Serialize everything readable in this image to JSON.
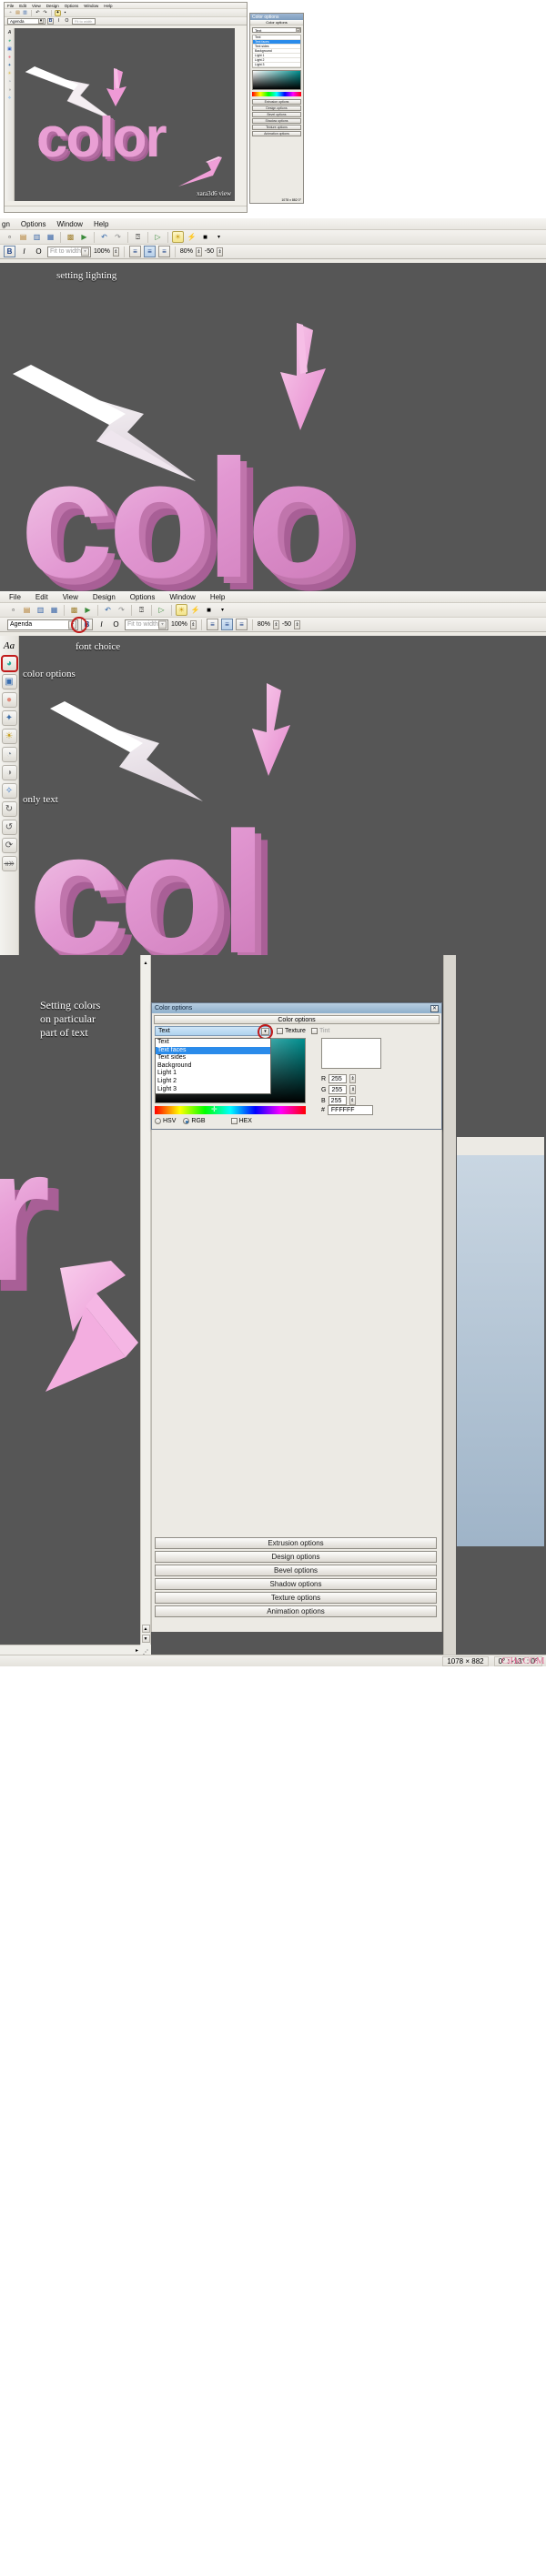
{
  "app": {
    "name": "Xara3D",
    "menu": [
      "File",
      "Edit",
      "View",
      "Design",
      "Options",
      "Window",
      "Help"
    ],
    "menu_short": [
      "gn",
      "Options",
      "Window",
      "Help"
    ]
  },
  "toolbar": {
    "icons": [
      {
        "name": "new-document-icon",
        "glyph": "□"
      },
      {
        "name": "open-folder-icon",
        "glyph": "❐"
      },
      {
        "name": "save-icon",
        "glyph": "▤"
      },
      {
        "name": "export-icon",
        "glyph": "▨"
      },
      {
        "name": "import-animation-icon",
        "glyph": "☷"
      },
      {
        "name": "export-animation-icon",
        "glyph": "▶"
      },
      {
        "name": "undo-icon",
        "glyph": "↶"
      },
      {
        "name": "redo-icon",
        "glyph": "↷"
      },
      {
        "name": "text-cursor-icon",
        "glyph": "⌶"
      },
      {
        "name": "play-animation-icon",
        "glyph": "▷"
      },
      {
        "name": "lighting-bulb-icon",
        "glyph": "💡"
      },
      {
        "name": "lightning-icon",
        "glyph": "⚡"
      },
      {
        "name": "background-icon",
        "glyph": "■"
      },
      {
        "name": "more-icon",
        "glyph": "▾"
      }
    ]
  },
  "fontbar": {
    "font_name": "Agenda",
    "bold_label": "B",
    "italic_label": "I",
    "outline_label": "O",
    "fit_mode": "Fit to width",
    "zoom": "100%",
    "align_left": "≡",
    "align_center": "≡",
    "align_right": "≡",
    "tracking": "80%",
    "leading": "-50"
  },
  "rail": {
    "items": [
      {
        "name": "text-options-icon",
        "glyph": "Aa"
      },
      {
        "name": "color-options-icon",
        "glyph": "🎨"
      },
      {
        "name": "extrusion-options-icon",
        "glyph": "▣"
      },
      {
        "name": "bevel-options-icon",
        "glyph": "●"
      },
      {
        "name": "design-options-icon",
        "glyph": "✦"
      },
      {
        "name": "lighting-options-icon",
        "glyph": "💡"
      },
      {
        "name": "texture-options-icon",
        "glyph": "◕"
      },
      {
        "name": "shadow-options-icon",
        "glyph": "◑"
      },
      {
        "name": "animation-options-icon",
        "glyph": "⌘"
      },
      {
        "name": "rotate-x-icon",
        "glyph": "↻"
      },
      {
        "name": "rotate-y-icon",
        "glyph": "↺"
      },
      {
        "name": "rotate-z-icon",
        "glyph": "⟳"
      },
      {
        "name": "reset-rotation-icon",
        "glyph": "⥁"
      }
    ]
  },
  "panel1": {
    "annotation": "xara3d6 view",
    "side_panel": {
      "title": "Color options",
      "group_label": "Color options",
      "rows": [
        "Text",
        "Text faces",
        "Text sides",
        "Background",
        "Light 1",
        "Light 2",
        "Light 3"
      ],
      "option_buttons": [
        "Extrusion options",
        "Design options",
        "Bevel options",
        "Shadow options",
        "Texture options",
        "Animation options"
      ],
      "status": "1078 x 882  0°"
    }
  },
  "panel2": {
    "menu": [
      "gn",
      "Options",
      "Window",
      "Help"
    ],
    "annotation": "setting lighting",
    "artwork_text": "colo"
  },
  "panel3": {
    "annotation_font": "font choice",
    "annotation_color": "color options",
    "annotation_text": "only text",
    "artwork_text": "col"
  },
  "panel4": {
    "annotation_lines": [
      "Setting colors",
      "on particular",
      "part of text"
    ],
    "artwork_text": "r"
  },
  "color_dialog": {
    "title": "Color options",
    "group_label": "Color options",
    "target_selected": "Text",
    "target_options": [
      "Text",
      "Text faces",
      "Text sides",
      "Background",
      "Light 1",
      "Light 2",
      "Light 3"
    ],
    "highlighted_option": "Text faces",
    "texture_label": "Texture",
    "tint_label": "Tint",
    "channels": [
      {
        "label": "R",
        "value": "255"
      },
      {
        "label": "G",
        "value": "255"
      },
      {
        "label": "B",
        "value": "255"
      }
    ],
    "hex_symbol": "#",
    "hex_value": "FFFFFF",
    "modes": [
      {
        "label": "HSV",
        "selected": false
      },
      {
        "label": "RGB",
        "selected": true
      }
    ],
    "hex_checkbox_label": "HEX",
    "option_buttons": [
      "Extrusion options",
      "Design options",
      "Bevel options",
      "Shadow options",
      "Texture options",
      "Animation options"
    ]
  },
  "statusbar": {
    "dimensions": "1078 × 882",
    "rotation": "0° : -13° : 0°",
    "watermark": "CiHe.COM"
  },
  "colors": {
    "canvas_bg": "#565656",
    "text_pink": "#dd8cc8",
    "text_pink_light": "#f2c2e2",
    "accent_red": "#c11a1a",
    "chrome": "#eceae4",
    "title_blue": "#8fb0cc"
  }
}
